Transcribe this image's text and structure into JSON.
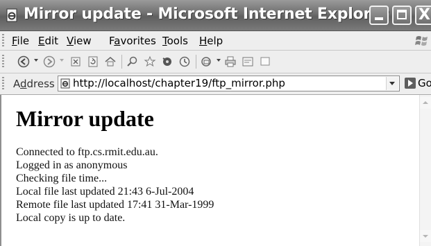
{
  "window": {
    "title": "Mirror update - Microsoft Internet Explorer",
    "icon": "ie-page-icon",
    "controls": [
      "minimize",
      "maximize",
      "close"
    ],
    "close_glyph": "X"
  },
  "menu": {
    "items": [
      {
        "label": "File"
      },
      {
        "label": "Edit"
      },
      {
        "label": "View"
      },
      {
        "label": "Favorites"
      },
      {
        "label": "Tools"
      },
      {
        "label": "Help"
      }
    ]
  },
  "toolbar": {
    "buttons": [
      "back-icon",
      "forward-icon",
      "stop-icon",
      "refresh-icon",
      "home-icon",
      "search-icon",
      "favorites-icon",
      "media-icon",
      "history-icon",
      "mail-icon",
      "print-icon",
      "edit-icon",
      "discuss-icon"
    ]
  },
  "address": {
    "label": "Address",
    "url": "http://localhost/chapter19/ftp_mirror.php",
    "go_label": "Go"
  },
  "page": {
    "heading": "Mirror update",
    "lines": [
      "Connected to ftp.cs.rmit.edu.au.",
      "Logged in as anonymous",
      "Checking file time...",
      "Local file last updated 21:43 6-Jul-2004",
      "Remote file last updated 17:41 31-Mar-1999",
      "Local copy is up to date."
    ]
  }
}
